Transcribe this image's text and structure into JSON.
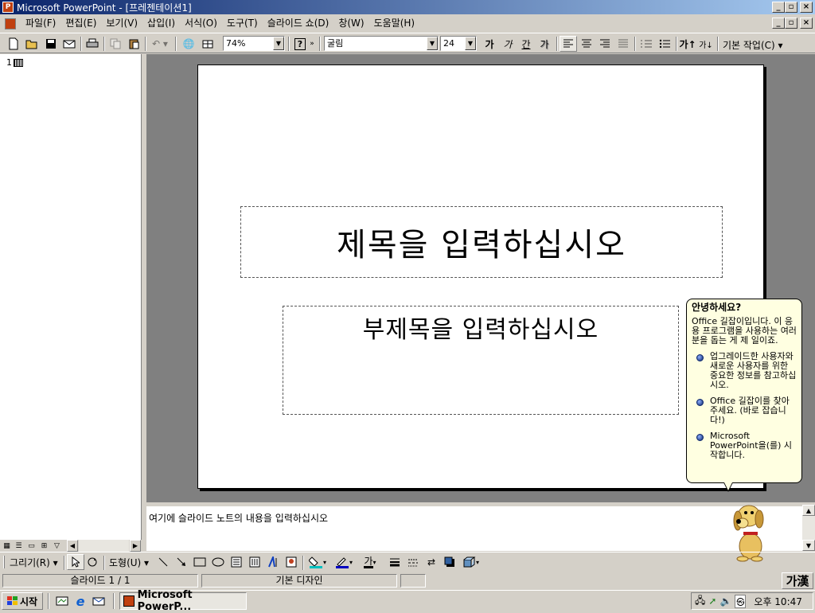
{
  "window": {
    "title": "Microsoft PowerPoint - [프레젠테이션1]",
    "app_icon": "P"
  },
  "menubar": {
    "items": [
      "파일(F)",
      "편집(E)",
      "보기(V)",
      "삽입(I)",
      "서식(O)",
      "도구(T)",
      "슬라이드 쇼(D)",
      "창(W)",
      "도움말(H)"
    ]
  },
  "toolbar": {
    "zoom": "74%",
    "font": "굴림",
    "font_size": "24",
    "help": "?",
    "char_labels": [
      "가",
      "가",
      "간",
      "가"
    ],
    "common_tasks": "기본 작업(C)"
  },
  "outline": {
    "slide_number": "1"
  },
  "slide": {
    "title_placeholder": "제목을 입력하십시오",
    "subtitle_placeholder": "부제목을 입력하십시오"
  },
  "notes": {
    "placeholder": "여기에 슬라이드 노트의 내용을 입력하십시오"
  },
  "assistant": {
    "heading": "안녕하세요?",
    "intro": "Office 길잡이입니다. 이 응용 프로그램을 사용하는 여러분을 돕는 게 제 일이죠.",
    "options": [
      "업그레이드한 사용자와 새로운 사용자를 위한 중요한 정보를 참고하십시오.",
      "Office 길잡이를 찾아 주세요. (바로 잡습니다!)",
      "Microsoft PowerPoint을(를) 시작합니다."
    ]
  },
  "drawbar": {
    "draw_menu": "그리기(R)",
    "autoshapes": "도형(U)"
  },
  "statusbar": {
    "slide_position": "슬라이드 1 / 1",
    "design": "기본 디자인",
    "ime": "가漢"
  },
  "taskbar": {
    "start_label": "시작",
    "task_label": "Microsoft PowerP...",
    "clock": "오후 10:47"
  }
}
